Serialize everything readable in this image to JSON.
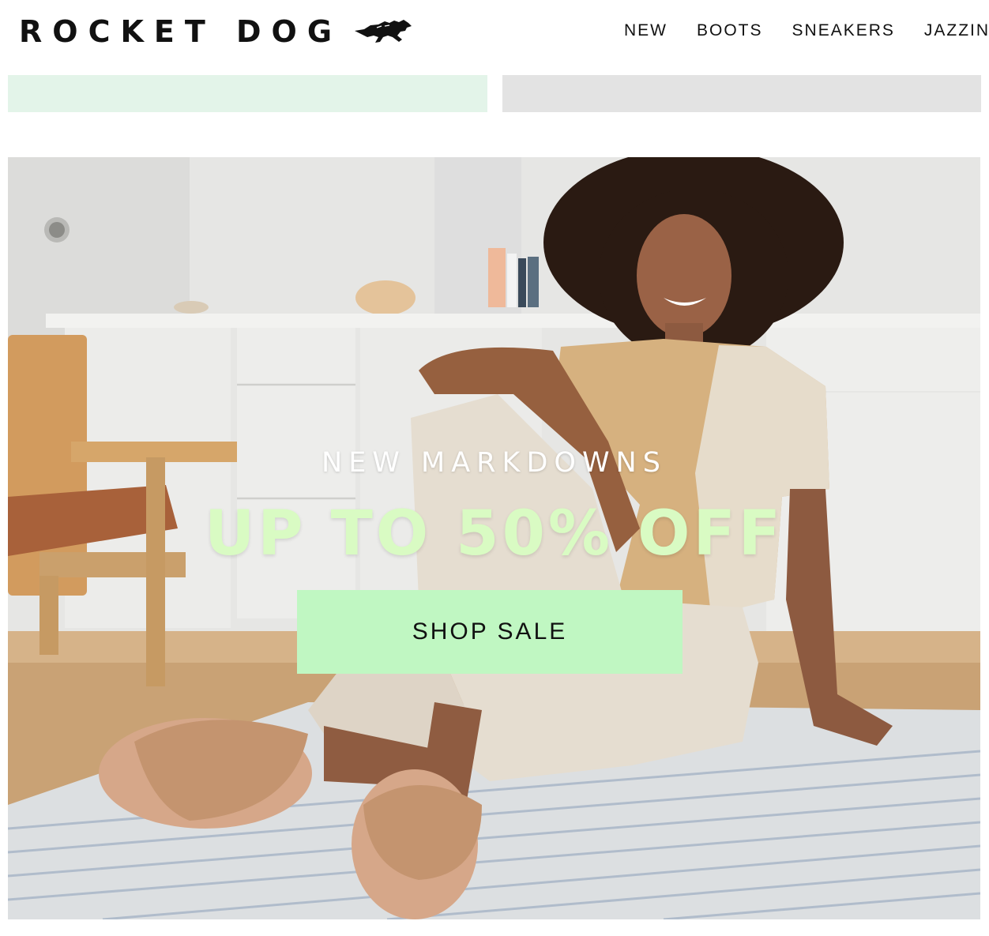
{
  "brand": {
    "name": "ROCKET DOG",
    "logo_icon": "running-dog-icon"
  },
  "nav": {
    "items": [
      {
        "label": "NEW"
      },
      {
        "label": "BOOTS"
      },
      {
        "label": "SNEAKERS"
      },
      {
        "label": "JAZZIN"
      }
    ]
  },
  "hero": {
    "kicker": "NEW MARKDOWNS",
    "headline": "UP TO 50% OFF",
    "cta_label": "SHOP SALE"
  },
  "colors": {
    "promo_left": "#e3f4e9",
    "promo_right": "#e3e3e3",
    "headline": "#d9fbc3",
    "cta_bg": "#c0f7c2"
  }
}
